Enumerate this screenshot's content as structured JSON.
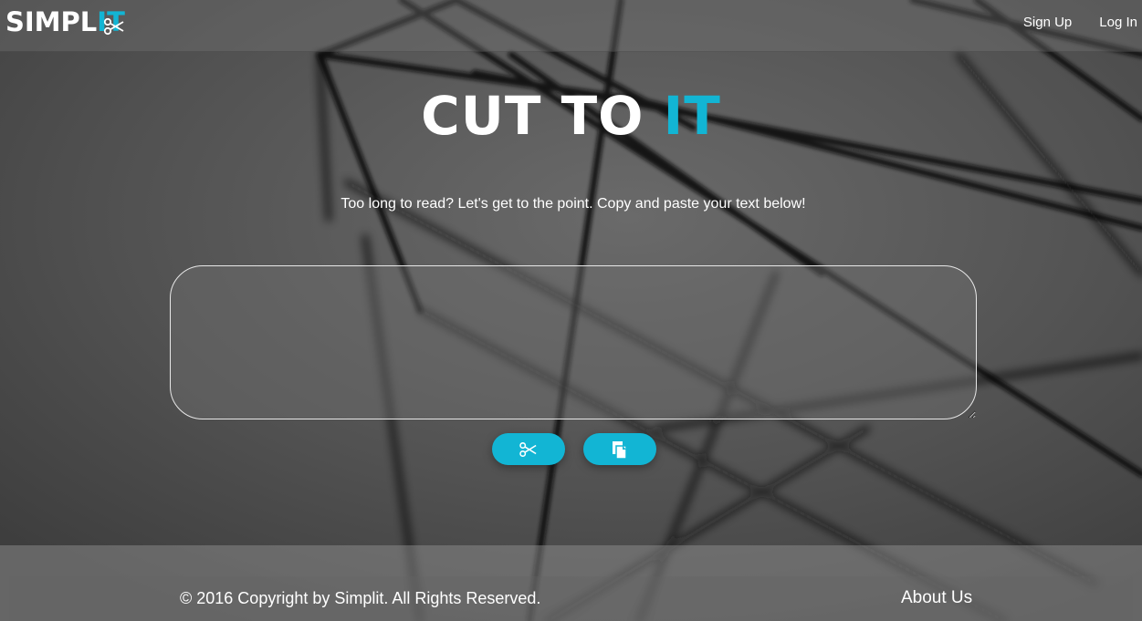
{
  "header": {
    "logo_main": "SIMPL",
    "logo_accent": "IT",
    "nav": [
      {
        "label": "Sign Up"
      },
      {
        "label": "Log In"
      }
    ]
  },
  "hero": {
    "title_main": "CUT TO ",
    "title_accent": "IT",
    "tagline": "Too long to read? Let's get to the point. Copy and paste your text below!"
  },
  "input": {
    "value": "",
    "placeholder": ""
  },
  "actions": [
    {
      "icon": "scissors-icon"
    },
    {
      "icon": "paste-icon"
    }
  ],
  "footer": {
    "copyright": "© 2016 Copyright by Simplit. All Rights Reserved.",
    "about": "About Us"
  },
  "colors": {
    "accent": "#12b5d4",
    "text": "#ffffff",
    "background": "#4e4e4e"
  }
}
